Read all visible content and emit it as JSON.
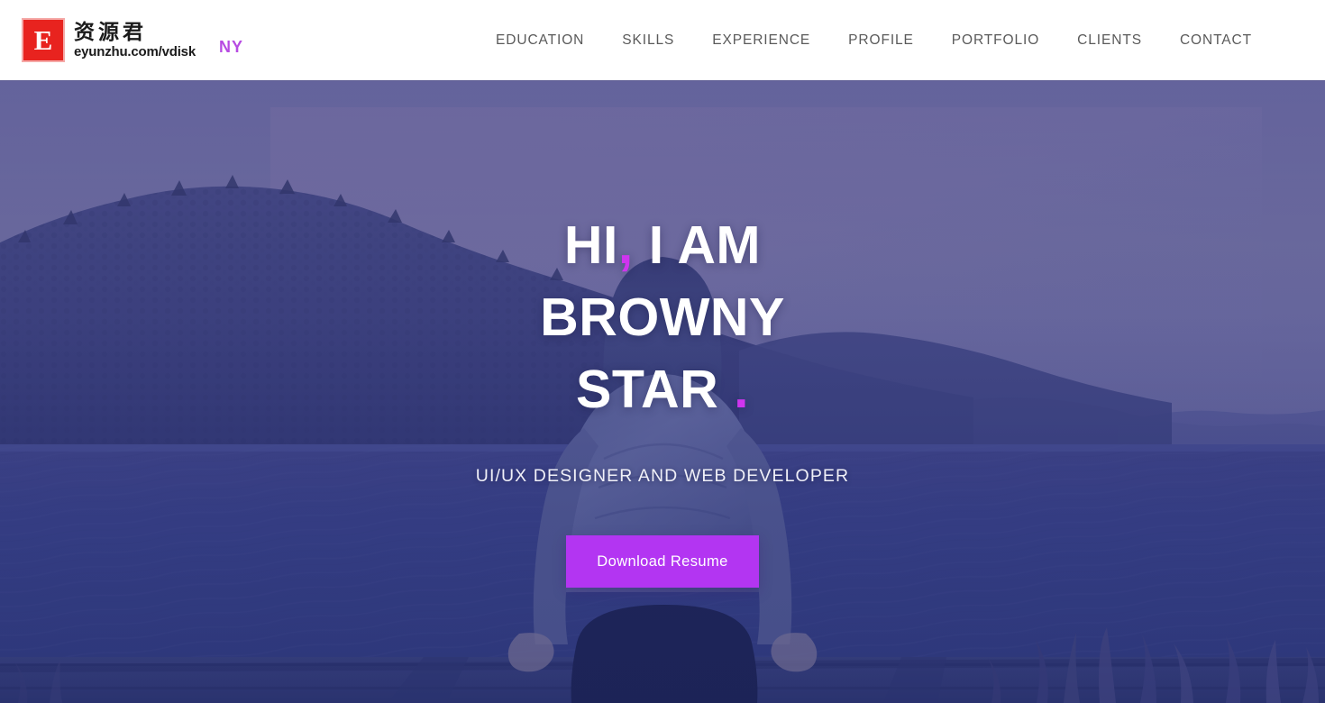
{
  "header": {
    "brand": {
      "mark_letter": "E",
      "cn_name": "资源君",
      "url": "eyunzhu.com/vdisk",
      "badge": "NY",
      "mark_color": "#e8231f",
      "badge_color": "#b13ce0"
    },
    "nav": [
      {
        "label": "EDUCATION"
      },
      {
        "label": "SKILLS"
      },
      {
        "label": "EXPERIENCE"
      },
      {
        "label": "PROFILE"
      },
      {
        "label": "PORTFOLIO"
      },
      {
        "label": "CLIENTS"
      },
      {
        "label": "CONTACT"
      }
    ]
  },
  "hero": {
    "title_line1_a": "HI",
    "title_line1_accent": ",",
    "title_line1_b": "I AM",
    "title_line2": "BROWNY",
    "title_line3": "STAR",
    "title_line3_accent": ".",
    "subtitle": "UI/UX DESIGNER AND WEB DEVELOPER",
    "cta_label": "Download Resume",
    "cta_color": "#b335f2",
    "accent_color": "#cf35ef",
    "overlay_color": "#4a4a96",
    "background_alt": "Woman sitting on a wooden dock facing a lake with mountains at dusk"
  }
}
